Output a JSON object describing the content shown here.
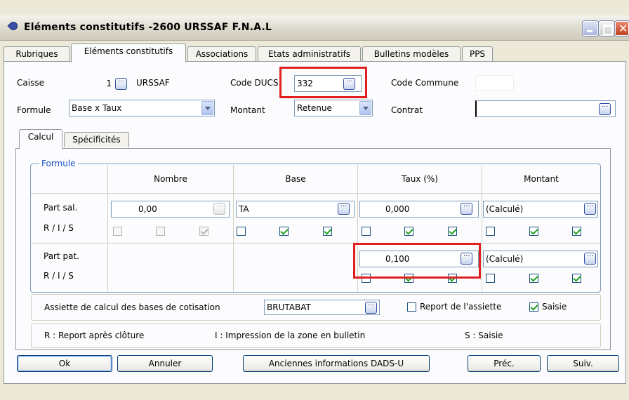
{
  "window": {
    "title": "Eléments constitutifs -2600 URSSAF F.N.A.L"
  },
  "tabs": [
    "Rubriques",
    "Eléments constitutifs",
    "Associations",
    "Etats administratifs",
    "Bulletins modèles",
    "PPS"
  ],
  "header": {
    "caisse_label": "Caisse",
    "caisse_value": "1",
    "caisse_name": "URSSAF",
    "code_ducs_label": "Code DUCS",
    "code_ducs_value": "332",
    "code_commune_label": "Code Commune",
    "formule_label": "Formule",
    "formule_value": "Base x Taux",
    "montant_label": "Montant",
    "montant_value": "Retenue",
    "contrat_label": "Contrat",
    "contrat_value": ""
  },
  "subtabs": [
    "Calcul",
    "Spécificités"
  ],
  "formule": {
    "legend": "Formule",
    "columns": [
      "Nombre",
      "Base",
      "Taux (%)",
      "Montant"
    ],
    "rows": [
      {
        "label": "Part sal.",
        "ris_label": "R / I / S",
        "nombre": "0,00",
        "base": "TA",
        "taux": "0,000",
        "montant": "(Calculé)",
        "nombre_checks": [
          false,
          false,
          true
        ],
        "base_checks": [
          false,
          true,
          true
        ],
        "taux_checks": [
          false,
          true,
          true
        ],
        "montant_checks": [
          false,
          true,
          true
        ]
      },
      {
        "label": "Part pat.",
        "ris_label": "R / I / S",
        "taux": "0,100",
        "montant": "(Calculé)",
        "taux_checks": [
          false,
          true,
          true
        ],
        "montant_checks": [
          false,
          true,
          true
        ]
      }
    ]
  },
  "assiette": {
    "label": "Assiette de calcul des bases de cotisation",
    "value": "BRUTABAT",
    "report_label": "Report de l'assiette",
    "report_checked": false,
    "saisie_label": "Saisie",
    "saisie_checked": true
  },
  "legend_line": {
    "r": "R : Report après clôture",
    "i": "I : Impression de la zone en bulletin",
    "s": "S : Saisie"
  },
  "buttons": {
    "ok": "Ok",
    "annuler": "Annuler",
    "anciennes": "Anciennes informations DADS-U",
    "prec": "Préc.",
    "suiv": "Suiv."
  }
}
